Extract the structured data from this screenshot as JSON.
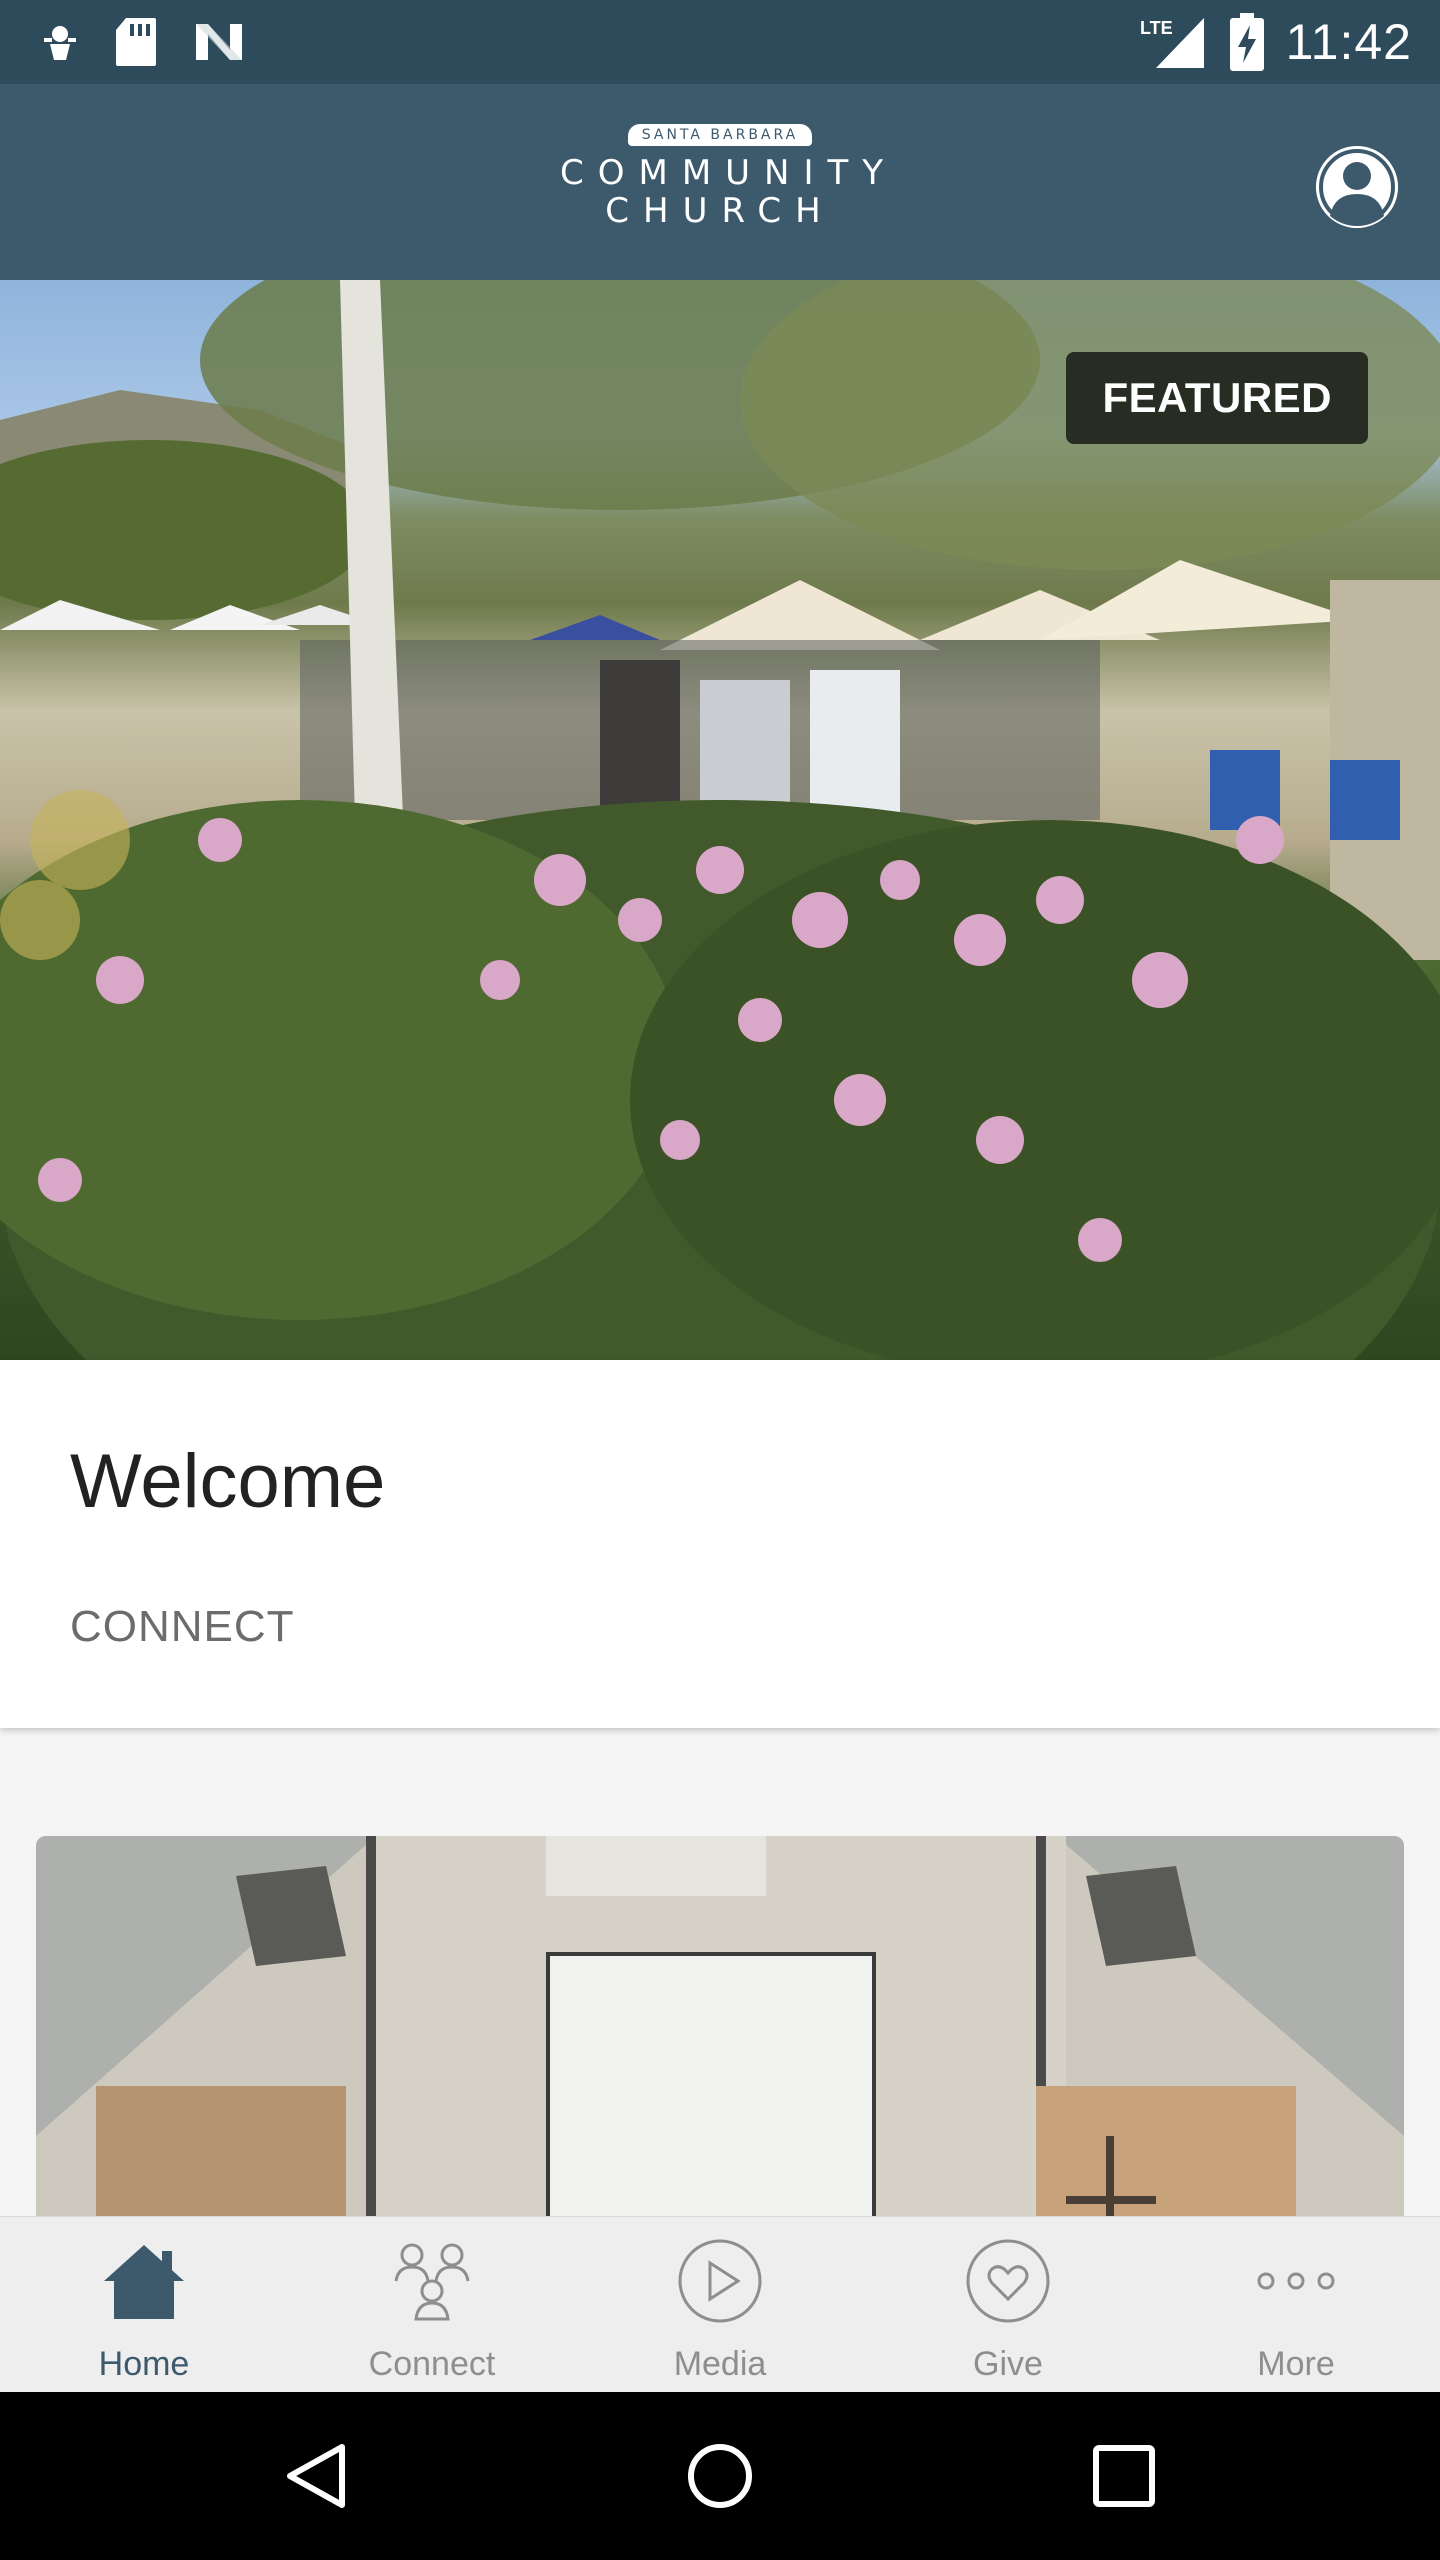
{
  "status_bar": {
    "time": "11:42",
    "network": "LTE",
    "left_icons": [
      "notification-icon",
      "sd-card-icon",
      "n-app-icon"
    ],
    "right_icons": [
      "lte-signal-icon",
      "battery-charging-icon"
    ]
  },
  "header": {
    "logo_top": "SANTA BARBARA",
    "logo_line1": "COMMUNITY",
    "logo_line2": "CHURCH",
    "profile_icon": "user-profile-icon"
  },
  "hero": {
    "badge": "FEATURED"
  },
  "welcome": {
    "title": "Welcome",
    "subtitle": "CONNECT"
  },
  "bottom_nav": {
    "items": [
      {
        "label": "Home",
        "icon": "home-icon",
        "active": true
      },
      {
        "label": "Connect",
        "icon": "people-icon",
        "active": false
      },
      {
        "label": "Media",
        "icon": "play-icon",
        "active": false
      },
      {
        "label": "Give",
        "icon": "heart-icon",
        "active": false
      },
      {
        "label": "More",
        "icon": "more-icon",
        "active": false
      }
    ]
  },
  "colors": {
    "status_bar": "#2e4b5c",
    "header": "#3d5a6c",
    "accent": "#3d5a6c",
    "nav_inactive": "#8e8e8e"
  }
}
